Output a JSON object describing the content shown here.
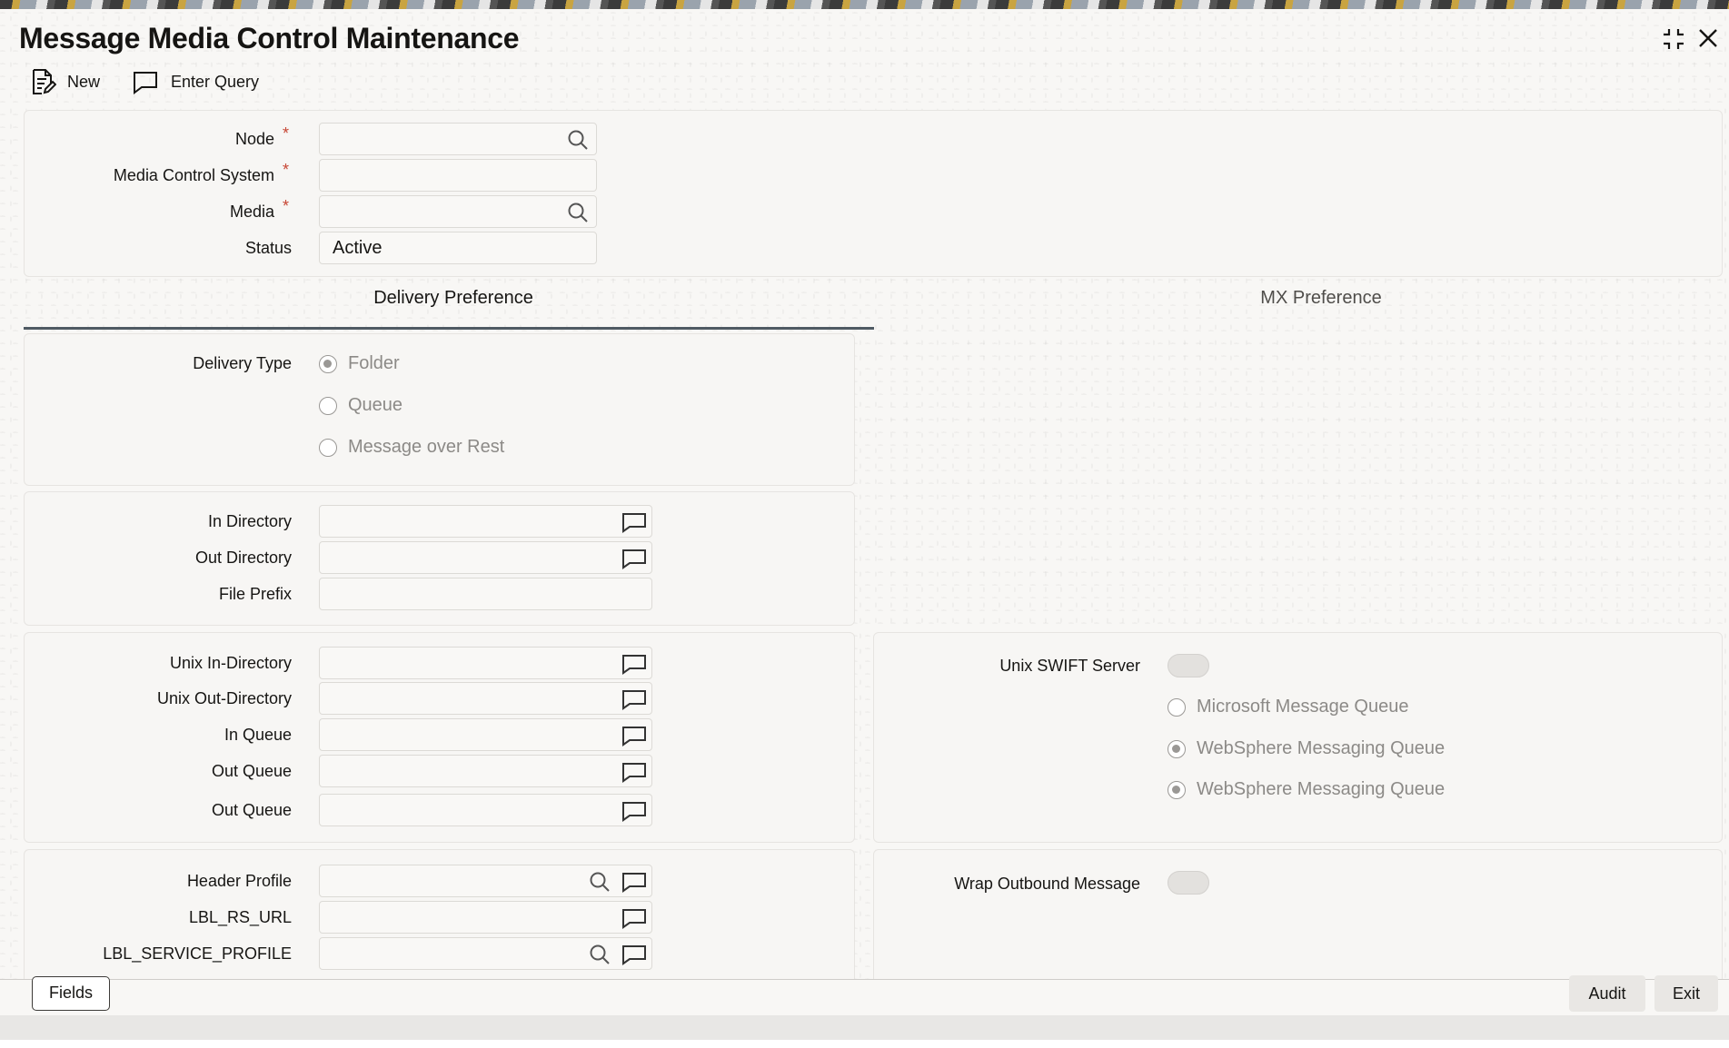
{
  "window": {
    "title": "Message Media Control Maintenance"
  },
  "toolbar": {
    "new_label": "New",
    "enter_query_label": "Enter Query"
  },
  "header_form": {
    "node_label": "Node",
    "media_control_system_label": "Media Control System",
    "media_label": "Media",
    "status_label": "Status",
    "status_value": "Active",
    "required_marker": "*"
  },
  "tabs": {
    "delivery_preference": "Delivery Preference",
    "mx_preference": "MX Preference",
    "active": "Delivery Preference"
  },
  "delivery": {
    "delivery_type_label": "Delivery Type",
    "options": [
      {
        "label": "Folder",
        "selected": true
      },
      {
        "label": "Queue",
        "selected": false
      },
      {
        "label": "Message over Rest",
        "selected": false
      }
    ]
  },
  "folder_section": {
    "in_directory_label": "In Directory",
    "out_directory_label": "Out Directory",
    "file_prefix_label": "File Prefix"
  },
  "unix_section": {
    "unix_in_directory_label": "Unix In-Directory",
    "unix_out_directory_label": "Unix Out-Directory",
    "in_queue_label": "In Queue",
    "out_queue_label_1": "Out Queue",
    "out_queue_label_2": "Out Queue"
  },
  "swift_section": {
    "unix_swift_server_label": "Unix SWIFT Server",
    "queue_options": [
      {
        "label": "Microsoft Message Queue",
        "selected": false
      },
      {
        "label": "WebSphere Messaging Queue",
        "selected": true
      },
      {
        "label": "WebSphere Messaging Queue",
        "selected": true
      }
    ]
  },
  "profile_section": {
    "header_profile_label": "Header Profile",
    "rs_url_label": "LBL_RS_URL",
    "service_profile_label": "LBL_SERVICE_PROFILE"
  },
  "wrap_section": {
    "wrap_outbound_label": "Wrap Outbound Message"
  },
  "footer": {
    "fields_label": "Fields",
    "audit_label": "Audit",
    "exit_label": "Exit"
  },
  "colors": {
    "required": "#c74634",
    "tab_underline": "#4f5a63"
  }
}
